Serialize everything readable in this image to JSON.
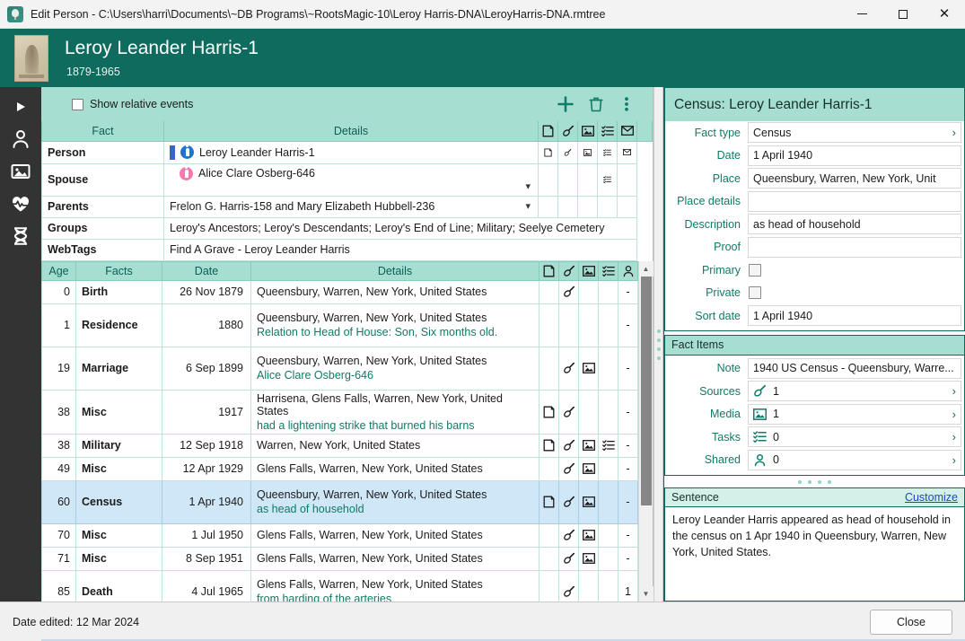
{
  "window": {
    "title": "Edit Person - C:\\Users\\harri\\Documents\\~DB Programs\\~RootsMagic-10\\Leroy Harris-DNA\\LeroyHarris-DNA.rmtree",
    "icon": "rootsmagic-tree-icon",
    "minimize_label": "Minimize",
    "maximize_label": "Maximize",
    "close_label": "Close"
  },
  "banner": {
    "name": "Leroy Leander Harris-1",
    "years": "1879-1965",
    "photo_alt": "portrait-photo"
  },
  "rail": {
    "items": [
      {
        "name": "play-icon",
        "label": "Play"
      },
      {
        "name": "person-icon",
        "label": "Person"
      },
      {
        "name": "image-icon",
        "label": "Media"
      },
      {
        "name": "heartbeat-icon",
        "label": "Health"
      },
      {
        "name": "dna-icon",
        "label": "DNA"
      }
    ]
  },
  "toolbar": {
    "show_relative_events_label": "Show relative events",
    "show_relative_events_checked": false,
    "add_label": "Add",
    "delete_label": "Delete",
    "more_label": "More options"
  },
  "top_grid": {
    "headers": {
      "fact": "Fact",
      "details": "Details",
      "icons": [
        "note-icon",
        "source-icon",
        "media-icon",
        "tasks-icon",
        "mail-icon"
      ]
    },
    "rows": [
      {
        "fact": "Person",
        "details": "Leroy Leander Harris-1",
        "sex": "male",
        "has_sexbar": true,
        "has_caret": false,
        "icons": [
          "note-icon",
          "source-icon",
          "media-icon",
          "tasks-icon",
          "mail-icon"
        ]
      },
      {
        "fact": "Spouse",
        "details": "Alice Clare Osberg-646",
        "sex": "female",
        "has_sexbar": false,
        "has_caret": true,
        "icons": [
          "tasks-icon"
        ]
      },
      {
        "fact": "Parents",
        "details": "Frelon G. Harris-158 and Mary Elizabeth Hubbell-236",
        "sex": "",
        "has_sexbar": false,
        "has_caret": true,
        "icons": []
      },
      {
        "fact": "Groups",
        "details": "Leroy's Ancestors; Leroy's Descendants; Leroy's End of Line; Military; Seelye Cemetery",
        "sex": "",
        "has_sexbar": false,
        "has_caret": false,
        "icons": []
      },
      {
        "fact": "WebTags",
        "details": "Find A Grave - Leroy Leander Harris",
        "sex": "",
        "has_sexbar": false,
        "has_caret": false,
        "icons": []
      }
    ]
  },
  "fact_list": {
    "headers": {
      "age": "Age",
      "facts": "Facts",
      "date": "Date",
      "details": "Details",
      "icons": [
        "note-icon",
        "source-icon",
        "media-icon",
        "tasks-icon",
        "shared-icon"
      ]
    },
    "rows": [
      {
        "age": "0",
        "fact": "Birth",
        "date": "26 Nov 1879",
        "place": "Queensbury, Warren, New York, United States",
        "note": "",
        "note_icon": false,
        "source_icon": true,
        "media_icon": false,
        "task_icon": false,
        "shared": "-",
        "selected": false
      },
      {
        "age": "1",
        "fact": "Residence",
        "date": "1880",
        "place": "Queensbury, Warren, New York, United States",
        "note": "Relation to Head of House: Son, Six months old.",
        "note_icon": false,
        "source_icon": false,
        "media_icon": false,
        "task_icon": false,
        "shared": "-",
        "selected": false
      },
      {
        "age": "19",
        "fact": "Marriage",
        "date": "6 Sep 1899",
        "place": "Queensbury, Warren, New York, United States",
        "note": "Alice Clare Osberg-646",
        "note_icon": false,
        "source_icon": true,
        "media_icon": true,
        "task_icon": false,
        "shared": "-",
        "selected": false
      },
      {
        "age": "38",
        "fact": "Misc",
        "date": "1917",
        "place": "Harrisena, Glens Falls, Warren, New York, United States",
        "note": "had a  lightening strike that burned his barns",
        "note_icon": true,
        "source_icon": true,
        "media_icon": false,
        "task_icon": false,
        "shared": "-",
        "selected": false
      },
      {
        "age": "38",
        "fact": "Military",
        "date": "12 Sep 1918",
        "place": "Warren, New York, United States",
        "note": "",
        "note_icon": true,
        "source_icon": true,
        "media_icon": true,
        "task_icon": true,
        "shared": "-",
        "selected": false
      },
      {
        "age": "49",
        "fact": "Misc",
        "date": "12 Apr 1929",
        "place": "Glens Falls, Warren, New York, United States",
        "note": "",
        "note_icon": false,
        "source_icon": true,
        "media_icon": true,
        "task_icon": false,
        "shared": "-",
        "selected": false
      },
      {
        "age": "60",
        "fact": "Census",
        "date": "1 Apr 1940",
        "place": "Queensbury, Warren, New York, United States",
        "note": "as head of household",
        "note_icon": true,
        "source_icon": true,
        "media_icon": true,
        "task_icon": false,
        "shared": "-",
        "selected": true
      },
      {
        "age": "70",
        "fact": "Misc",
        "date": "1 Jul 1950",
        "place": "Glens Falls, Warren, New York, United States",
        "note": "",
        "note_icon": false,
        "source_icon": true,
        "media_icon": true,
        "task_icon": false,
        "shared": "-",
        "selected": false
      },
      {
        "age": "71",
        "fact": "Misc",
        "date": "8 Sep 1951",
        "place": "Glens Falls, Warren, New York, United States",
        "note": "",
        "note_icon": false,
        "source_icon": true,
        "media_icon": true,
        "task_icon": false,
        "shared": "-",
        "selected": false
      },
      {
        "age": "85",
        "fact": "Death",
        "date": "4 Jul 1965",
        "place": "Glens Falls, Warren, New York, United States",
        "note": "from harding of the arteries",
        "note_icon": false,
        "source_icon": true,
        "media_icon": false,
        "task_icon": false,
        "shared": "1",
        "selected": false
      }
    ]
  },
  "right_panel": {
    "title": "Census: Leroy Leander Harris-1",
    "fields": [
      {
        "label": "Fact type",
        "value": "Census",
        "type": "picker"
      },
      {
        "label": "Date",
        "value": "1 April 1940",
        "type": "text"
      },
      {
        "label": "Place",
        "value": "Queensbury, Warren, New York, Unit",
        "type": "text"
      },
      {
        "label": "Place details",
        "value": "",
        "type": "text"
      },
      {
        "label": "Description",
        "value": "as head of household",
        "type": "text"
      },
      {
        "label": "Proof",
        "value": "",
        "type": "text"
      },
      {
        "label": "Primary",
        "value": "",
        "type": "checkbox",
        "checked": false
      },
      {
        "label": "Private",
        "value": "",
        "type": "checkbox",
        "checked": false
      },
      {
        "label": "Sort date",
        "value": "1 April 1940",
        "type": "text"
      }
    ],
    "fact_items_title": "Fact Items",
    "fact_items": [
      {
        "label": "Note",
        "value": "1940 US Census - Queensbury, Warre...",
        "icon": ""
      },
      {
        "label": "Sources",
        "value": "1",
        "icon": "source-icon"
      },
      {
        "label": "Media",
        "value": "1",
        "icon": "media-icon"
      },
      {
        "label": "Tasks",
        "value": "0",
        "icon": "tasks-icon"
      },
      {
        "label": "Shared",
        "value": "0",
        "icon": "shared-icon"
      }
    ],
    "sentence_title": "Sentence",
    "customize_label": "Customize",
    "sentence_text": "Leroy Leander Harris appeared as head of household in the census on 1 Apr 1940 in Queensbury, Warren, New York, United States."
  },
  "statusbar": {
    "date_edited": "Date edited: 12 Mar 2024",
    "close_button": "Close"
  },
  "colors": {
    "teal_dark": "#0f6b5e",
    "teal_header": "#a7ded2",
    "accent_green_text": "#117a65",
    "selection_blue": "#cfe7f7",
    "link_blue": "#1a47c8",
    "male_blue": "#1f74d0",
    "female_pink": "#f07bb0"
  }
}
